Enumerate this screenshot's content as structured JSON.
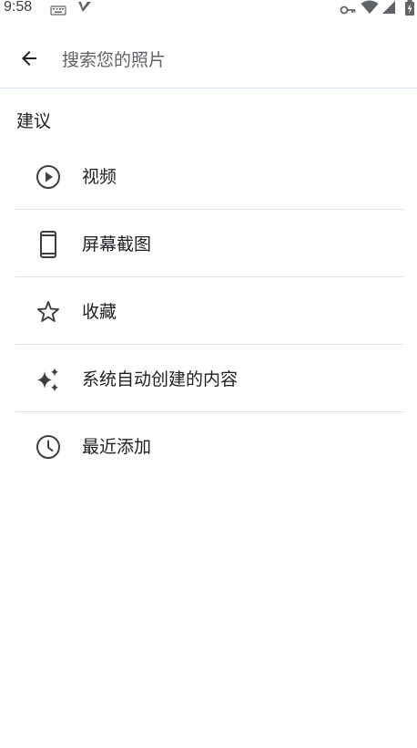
{
  "status_bar": {
    "time": "9:58",
    "icons": [
      "keyboard-icon",
      "check-icon",
      "vpn-key-icon",
      "wifi-icon",
      "signal-icon",
      "battery-charging-icon"
    ]
  },
  "search": {
    "placeholder": "搜索您的照片",
    "value": ""
  },
  "suggestions": {
    "title": "建议",
    "items": [
      {
        "label": "视频",
        "icon": "play-circle-icon"
      },
      {
        "label": "屏幕截图",
        "icon": "phone-icon"
      },
      {
        "label": "收藏",
        "icon": "star-icon"
      },
      {
        "label": "系统自动创建的内容",
        "icon": "sparkle-icon"
      },
      {
        "label": "最近添加",
        "icon": "clock-icon"
      }
    ]
  },
  "colors": {
    "text": "#202124",
    "icon": "#3c4043",
    "divider": "#e0e0e0",
    "app_bar_divider": "#d3e3f1"
  }
}
